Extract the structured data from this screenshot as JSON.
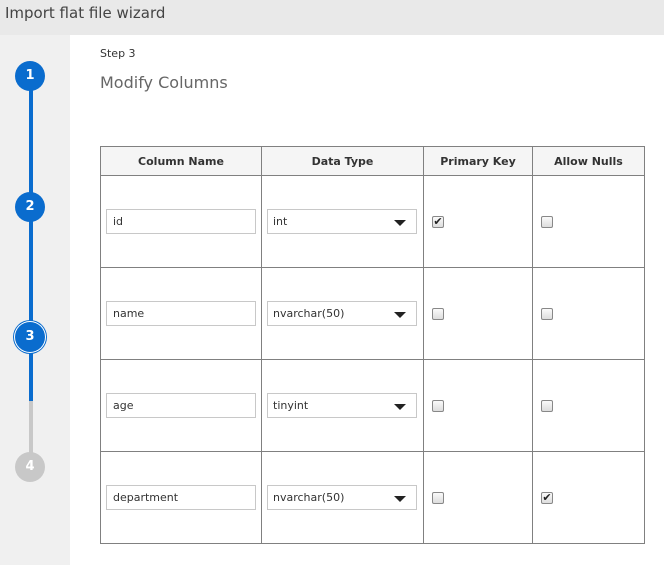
{
  "header": {
    "title": "Import flat file wizard"
  },
  "steps": [
    "1",
    "2",
    "3",
    "4"
  ],
  "main": {
    "step_label": "Step 3",
    "title": "Modify Columns"
  },
  "table": {
    "headers": [
      "Column Name",
      "Data Type",
      "Primary Key",
      "Allow Nulls"
    ],
    "rows": [
      {
        "name": "id",
        "type": "int",
        "primary_key": true,
        "allow_nulls": false
      },
      {
        "name": "name",
        "type": "nvarchar(50)",
        "primary_key": false,
        "allow_nulls": false
      },
      {
        "name": "age",
        "type": "tinyint",
        "primary_key": false,
        "allow_nulls": false
      },
      {
        "name": "department",
        "type": "nvarchar(50)",
        "primary_key": false,
        "allow_nulls": true
      }
    ]
  },
  "colors": {
    "accent": "#0a6cce",
    "inactive": "#c8c8c8"
  }
}
